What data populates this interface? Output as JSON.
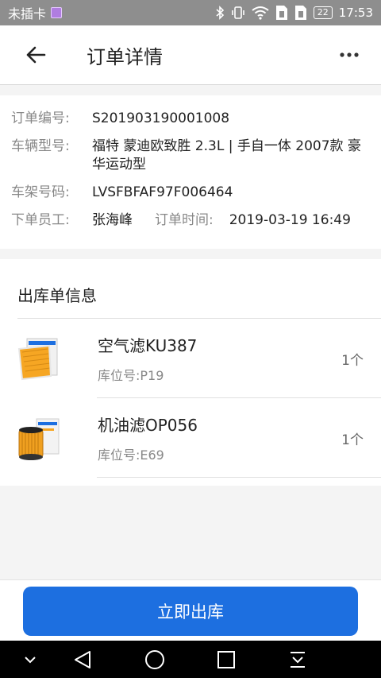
{
  "status_bar": {
    "carrier": "未插卡",
    "battery": "22",
    "time": "17:53",
    "icons": [
      "image-icon",
      "bluetooth-icon",
      "vibrate-icon",
      "wifi-icon",
      "sim1-icon",
      "sim2-icon",
      "battery-icon"
    ]
  },
  "header": {
    "title": "订单详情",
    "back_icon": "arrow-left-icon",
    "more_icon": "more-horizontal-icon"
  },
  "order": {
    "number_label": "订单编号:",
    "number": "S201903190001008",
    "vehicle_label": "车辆型号:",
    "vehicle": "福特 蒙迪欧致胜 2.3L | 手自一体 2007款 豪华运动型",
    "vin_label": "车架号码:",
    "vin": "LVSFBFAF97F006464",
    "staff_label": "下单员工:",
    "staff": "张海峰",
    "time_label": "订单时间:",
    "time": "2019-03-19 16:49"
  },
  "outbound": {
    "title": "出库单信息",
    "items": [
      {
        "name": "空气滤KU387",
        "location": "库位号:P19",
        "qty": "1个"
      },
      {
        "name": "机油滤OP056",
        "location": "库位号:E69",
        "qty": "1个"
      }
    ]
  },
  "action": {
    "label": "立即出库"
  },
  "nav": [
    "collapse-icon",
    "back-triangle-icon",
    "home-circle-icon",
    "recents-square-icon",
    "notification-pull-icon"
  ],
  "colors": {
    "primary": "#1d6fe0",
    "status_bar": "#8e8e8e"
  }
}
